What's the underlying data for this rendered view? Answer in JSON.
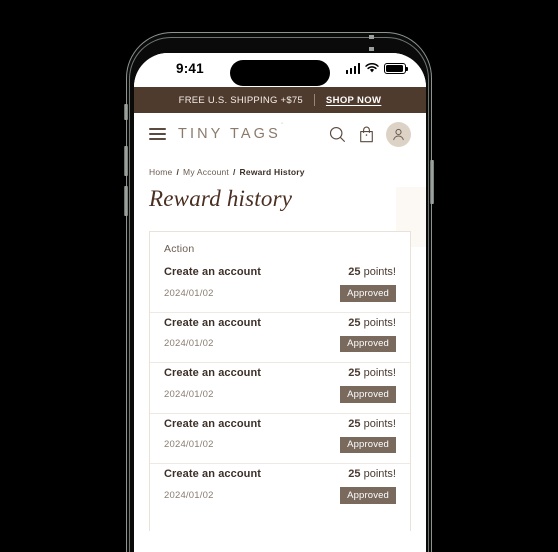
{
  "device": {
    "status_bar": {
      "time": "9:41",
      "signal_icon": "cellular-signal-icon",
      "wifi_icon": "wifi-icon",
      "battery_icon": "battery-icon"
    }
  },
  "announcement": {
    "text": "FREE U.S. SHIPPING +$75",
    "link_label": "SHOP NOW"
  },
  "header": {
    "menu_icon": "hamburger-menu-icon",
    "brand": "TINY TAGS",
    "brand_mark": "·",
    "search_icon": "search-icon",
    "bag_icon": "shopping-bag-icon",
    "account_icon": "user-account-icon"
  },
  "breadcrumb": {
    "items": [
      {
        "label": "Home",
        "current": false
      },
      {
        "label": "My Account",
        "current": false
      },
      {
        "label": "Reward History",
        "current": true
      }
    ],
    "separator": "/"
  },
  "page": {
    "title": "Reward history"
  },
  "reward_table": {
    "column_header": "Action",
    "points_suffix": "points!",
    "rows": [
      {
        "action": "Create an account",
        "points": "25",
        "date": "2024/01/02",
        "status": "Approved"
      },
      {
        "action": "Create an account",
        "points": "25",
        "date": "2024/01/02",
        "status": "Approved"
      },
      {
        "action": "Create an account",
        "points": "25",
        "date": "2024/01/02",
        "status": "Approved"
      },
      {
        "action": "Create an account",
        "points": "25",
        "date": "2024/01/02",
        "status": "Approved"
      },
      {
        "action": "Create an account",
        "points": "25",
        "date": "2024/01/02",
        "status": "Approved"
      }
    ]
  },
  "colors": {
    "announcement_bg": "#4f3a2e",
    "brand_text": "#8a7a6c",
    "title_text": "#4a2f22",
    "status_badge_bg": "#7a6a5e",
    "avatar_bg": "#ddd2c6"
  }
}
